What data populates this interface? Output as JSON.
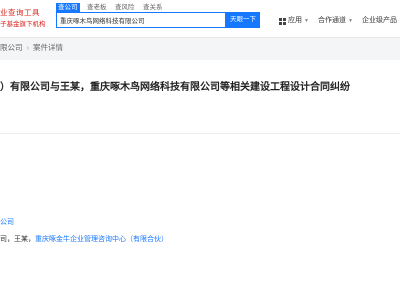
{
  "header": {
    "logo_line1": "业查询工具",
    "logo_line2": "子基金旗下机构",
    "search_tabs": [
      "查公司",
      "查老板",
      "查风险",
      "查关系"
    ],
    "search_value": "重庆啄木鸟网络科技有限公司",
    "search_button": "天眼一下",
    "nav": [
      {
        "label": "应用",
        "has_caret": true
      },
      {
        "label": "合作通道",
        "has_caret": true
      },
      {
        "label": "企业级产品",
        "has_caret": false
      }
    ]
  },
  "breadcrumb": {
    "parent": "限公司",
    "current": "案件详情"
  },
  "case": {
    "title": "）有限公司与王某，重庆啄木鸟网络科技有限公司等相关建设工程设计合同纠纷"
  },
  "parties": {
    "line1": "公司",
    "line2_prefix": "司，王某，",
    "line2_link": "重庆啄金牛企业管理咨询中心（有限合伙）"
  },
  "colors": {
    "accent": "#1677ff",
    "brand": "#d9251d"
  }
}
